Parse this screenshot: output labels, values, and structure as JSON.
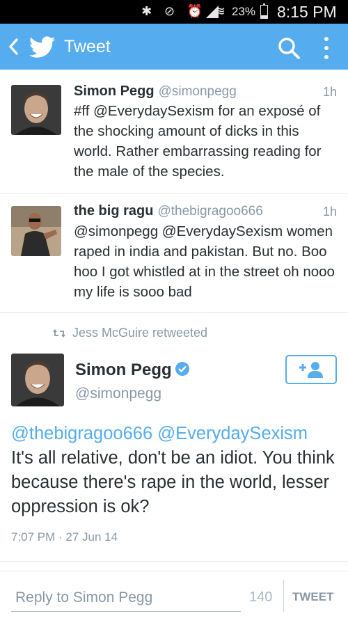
{
  "status_bar": {
    "icons": [
      "bluetooth-icon",
      "mute-icon",
      "alarm-icon",
      "wifi-icon",
      "signal-icon"
    ],
    "battery_percent": "23%",
    "battery_level": 0.23,
    "clock": "8:15 PM"
  },
  "app_bar": {
    "title": "Tweet",
    "color": "#55acee"
  },
  "tweets": [
    {
      "name": "Simon Pegg",
      "handle": "@simonpegg",
      "time": "1h",
      "text": "#ff @EverydaySexism for an exposé of the shocking amount of dicks in this world. Rather embarrassing reading for the male of the species."
    },
    {
      "name": "the big ragu",
      "handle": "@thebigragoo666",
      "time": "1h",
      "text": "@simonpegg @EverydaySexism women raped in india and pakistan. But no. Boo hoo I got whistled at in the street oh nooo my life is sooo bad"
    }
  ],
  "retweet_header": "Jess McGuire retweeted",
  "focused_tweet": {
    "name": "Simon Pegg",
    "handle": "@simonpegg",
    "mentions": "@thebigragoo666 @EverydaySexism",
    "text": "It's all relative, don't be an idiot. You think because there's rape in the world, lesser oppression is ok?",
    "timestamp": "7:07 PM · 27 Jun 14"
  },
  "reply_bar": {
    "placeholder": "Reply to Simon Pegg",
    "char_count": "140",
    "tweet_label": "TWEET"
  }
}
